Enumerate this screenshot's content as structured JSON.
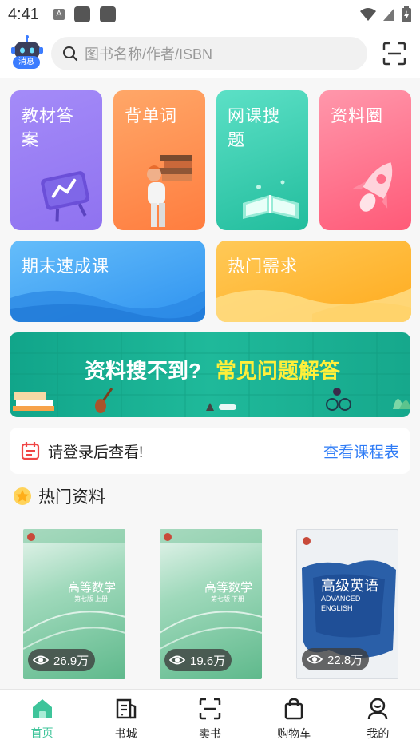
{
  "status_bar": {
    "time": "4:41"
  },
  "header": {
    "message_badge": "消息",
    "search_placeholder": "图书名称/作者/ISBN"
  },
  "tiles": [
    {
      "label": "教材答案",
      "color_from": "#9d7cf6",
      "color_to": "#b697ff"
    },
    {
      "label": "背单词",
      "color_from": "#ff9a5c",
      "color_to": "#ff7a3c"
    },
    {
      "label": "网课搜题",
      "color_from": "#4fd9bf",
      "color_to": "#2bc2a3"
    },
    {
      "label": "资料圈",
      "color_from": "#ff8fa5",
      "color_to": "#ff5c78"
    },
    {
      "label": "期末速成课",
      "color_from": "#5fb8f8",
      "color_to": "#2f95f0"
    },
    {
      "label": "热门需求",
      "color_from": "#ffc34a",
      "color_to": "#ffad22"
    }
  ],
  "banner": {
    "text_white": "资料搜不到?",
    "text_yellow": "常见问题解答"
  },
  "login": {
    "prompt": "请登录后查看!",
    "link": "查看课程表"
  },
  "hot": {
    "title": "热门资料",
    "books": [
      {
        "cover_title": "高等数学",
        "cover_sub": "第七版 上册",
        "views": "26.9万"
      },
      {
        "cover_title": "高等数学",
        "cover_sub": "第七版 下册",
        "views": "19.6万"
      },
      {
        "cover_title": "高级英语",
        "cover_sub": "ADVANCED ENGLISH",
        "views": "22.8万"
      }
    ]
  },
  "bottom_nav": [
    {
      "label": "首页",
      "icon": "home-icon",
      "active": true
    },
    {
      "label": "书城",
      "icon": "bookstore-icon",
      "active": false
    },
    {
      "label": "卖书",
      "icon": "sell-scan-icon",
      "active": false
    },
    {
      "label": "购物车",
      "icon": "shopping-bag-icon",
      "active": false
    },
    {
      "label": "我的",
      "icon": "profile-icon",
      "active": false
    }
  ],
  "colors": {
    "accent_green": "#3ec49a",
    "link_blue": "#2f7cf6",
    "banner_yellow": "#ffef3a"
  }
}
